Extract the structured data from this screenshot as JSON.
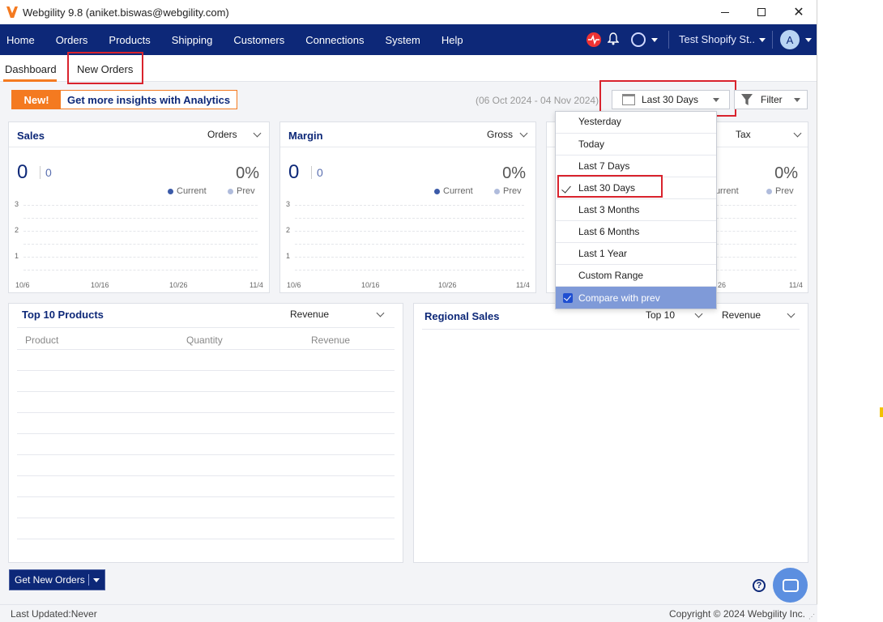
{
  "window": {
    "title": "Webgility 9.8 (aniket.biswas@webgility.com)"
  },
  "nav": {
    "items": [
      "Home",
      "Orders",
      "Products",
      "Shipping",
      "Customers",
      "Connections",
      "System",
      "Help"
    ],
    "store": "Test Shopify St..",
    "avatar": "A"
  },
  "tabs": {
    "dashboard": "Dashboard",
    "new_orders": "New Orders"
  },
  "banner": {
    "new": "New!",
    "text": "Get more insights with Analytics"
  },
  "toolbar": {
    "date_range": "(06 Oct 2024 - 04 Nov 2024)",
    "period": "Last 30 Days",
    "filter": "Filter"
  },
  "cards": [
    {
      "title": "Sales",
      "select": "Orders",
      "value": "0",
      "prev_value": "0",
      "pct": "0%",
      "legend_current": "Current",
      "legend_prev": "Prev"
    },
    {
      "title": "Margin",
      "select": "Gross",
      "value": "0",
      "prev_value": "0",
      "pct": "0%",
      "legend_current": "Current",
      "legend_prev": "Prev"
    },
    {
      "title": "",
      "select": "Tax",
      "value": "",
      "prev_value": "",
      "pct": "0%",
      "legend_current": "Current",
      "legend_prev": "Prev"
    }
  ],
  "chart_axis": {
    "yticks": [
      "3",
      "2",
      "1"
    ],
    "xticks": [
      "10/6",
      "10/16",
      "10/26",
      "11/4"
    ]
  },
  "dropdown": {
    "items": [
      "Yesterday",
      "Today",
      "Last 7 Days",
      "Last 30 Days",
      "Last 3 Months",
      "Last 6 Months",
      "Last 1 Year",
      "Custom Range"
    ],
    "selected": "Last 30 Days",
    "compare": "Compare with prev"
  },
  "top_products": {
    "title": "Top 10 Products",
    "select": "Revenue",
    "columns": [
      "Product",
      "Quantity",
      "Revenue"
    ]
  },
  "regional": {
    "title": "Regional Sales",
    "select1": "Top 10",
    "select2": "Revenue"
  },
  "bottom": {
    "get_orders": "Get New Orders",
    "help": "?",
    "last_updated": "Last Updated:Never",
    "copyright": "Copyright © 2024 Webgility Inc."
  },
  "colors": {
    "nav_bg": "#0d2878",
    "accent": "#f47a20",
    "highlight_box": "#d9232d",
    "current_dot": "#3b5aa8",
    "prev_dot": "#b0bcdc"
  }
}
